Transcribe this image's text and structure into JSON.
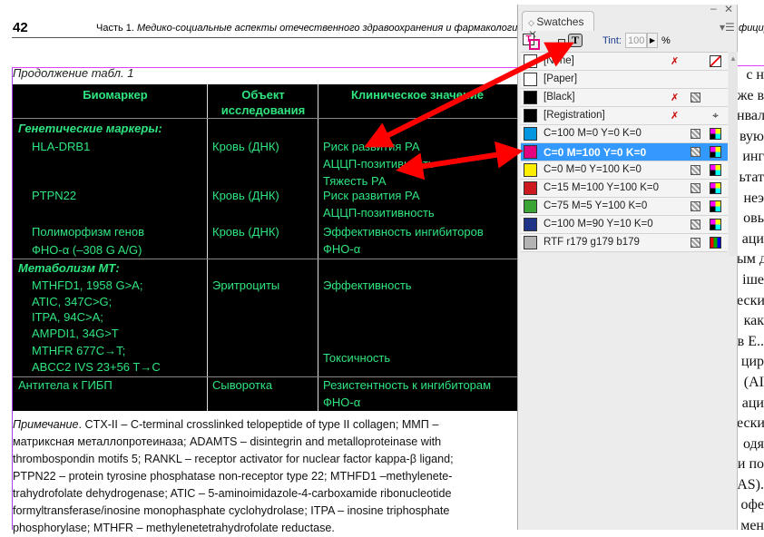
{
  "page": {
    "number": "42",
    "running_head_prefix": "Часть 1. ",
    "running_head_title": "Медико-социальные аспекты отечественного здравоохранения и фармакологии",
    "running_head_tail": "фицир"
  },
  "table": {
    "caption": "Продолжение табл. 1",
    "headers": [
      "Биомаркер",
      "Объект исследования",
      "Клиническое значение"
    ],
    "sections": [
      {
        "label": "Генетические маркеры:"
      },
      {
        "label": "Метаболизм МТ:"
      }
    ],
    "rows": [
      {
        "marker": [
          "HLA-DRB1"
        ],
        "object": "Кровь (ДНК)",
        "value": [
          "Риск развития РА",
          "АЦЦП-позитивность",
          "Тяжесть РА"
        ]
      },
      {
        "marker": [
          "PTPN22"
        ],
        "object": "Кровь (ДНК)",
        "value": [
          "Риск развития РА",
          "АЦЦП-позитивность"
        ]
      },
      {
        "marker": [
          "Полиморфизм генов",
          "ФНО-α (–308 G A/G)"
        ],
        "object": "Кровь (ДНК)",
        "value": [
          "Эффективность ингибиторов",
          "ФНО-α"
        ]
      },
      {
        "marker": [
          "MTHFD1, 1958 G>A;",
          "ATIC, 347C>G;",
          "ITPA, 94C>A;",
          "AMPDI1, 34G>T"
        ],
        "object": "Эритроциты",
        "value": [
          "Эффективность"
        ]
      },
      {
        "marker": [
          "MTHFR 677C→T;",
          "ABCC2 IVS 23+56 T→C"
        ],
        "object": "",
        "value": [
          "Токсичность"
        ]
      },
      {
        "marker": [
          "Антитела к ГИБП"
        ],
        "object": "Сыворотка",
        "value": [
          "Резистентность к ингибиторам",
          "ФНО-α"
        ]
      }
    ],
    "text_color": "#2fe57f"
  },
  "note": {
    "label": "Примечание",
    "lines": [
      ". CTX-II – C-terminal crosslinked telopeptide of type II collagen; ММП –",
      "матриксная металлопротеиназа; ADAMTS – disintegrin and metalloproteinase with",
      "thrombospondin motifs 5; RANKL – receptor activator for nuclear factor kappa-β ligand;",
      "PTPN22 – protein tyrosine phosphatase non-receptor type 22; MTHFD1 –methylenete-",
      "trahydrofolate dehydrogenase; ATIC – 5-aminoimidazole-4-carboxamide ribonucleotide",
      "formyltransferase/inosine monophasphate cyclohydrolase; ITPA – inosine triphosphate",
      "phosphorylase; MTHFR – methylenetetrahydrofolate reductase."
    ]
  },
  "right_column": [
    "с н",
    "же в",
    "нвал",
    "вую",
    "инг",
    "ьтат",
    "неэ",
    "овь",
    "аци",
    "ым д",
    "іше",
    "ески",
    "как",
    "в Е..",
    "цир",
    "(AI",
    "аци",
    "ески",
    "одя",
    "и по",
    "AS).",
    "офе",
    "мен"
  ],
  "panel": {
    "tab": "Swatches",
    "tint_label": "Tint:",
    "tint_value": "100",
    "tint_unit": "%",
    "swatches": [
      {
        "name": "[None]",
        "color": "#ffffff",
        "selected": false,
        "icons": [
          "no-edit",
          "none"
        ]
      },
      {
        "name": "[Paper]",
        "color": "#ffffff",
        "selected": false,
        "icons": []
      },
      {
        "name": "[Black]",
        "color": "#000000",
        "selected": false,
        "icons": [
          "no-edit",
          "process"
        ]
      },
      {
        "name": "[Registration]",
        "color": "#000000",
        "selected": false,
        "icons": [
          "no-edit",
          "registration"
        ]
      },
      {
        "name": "C=100 M=0 Y=0 K=0",
        "color": "#0096e0",
        "selected": false,
        "icons": [
          "process",
          "cmyk"
        ]
      },
      {
        "name": "C=0 M=100 Y=0 K=0",
        "color": "#e4007f",
        "selected": true,
        "icons": [
          "process",
          "cmyk"
        ]
      },
      {
        "name": "C=0 M=0 Y=100 K=0",
        "color": "#ffee00",
        "selected": false,
        "icons": [
          "process",
          "cmyk"
        ]
      },
      {
        "name": "C=15 M=100 Y=100 K=0",
        "color": "#cc1a1f",
        "selected": false,
        "icons": [
          "process",
          "cmyk"
        ]
      },
      {
        "name": "C=75 M=5 Y=100 K=0",
        "color": "#3aa535",
        "selected": false,
        "icons": [
          "process",
          "cmyk"
        ]
      },
      {
        "name": "C=100 M=90 Y=10 K=0",
        "color": "#1f3387",
        "selected": false,
        "icons": [
          "process",
          "cmyk"
        ]
      },
      {
        "name": "RTF r179 g179 b179",
        "color": "#b3b3b3",
        "selected": false,
        "icons": [
          "process",
          "rgb"
        ]
      }
    ]
  },
  "annotation_color": "#ff0000"
}
